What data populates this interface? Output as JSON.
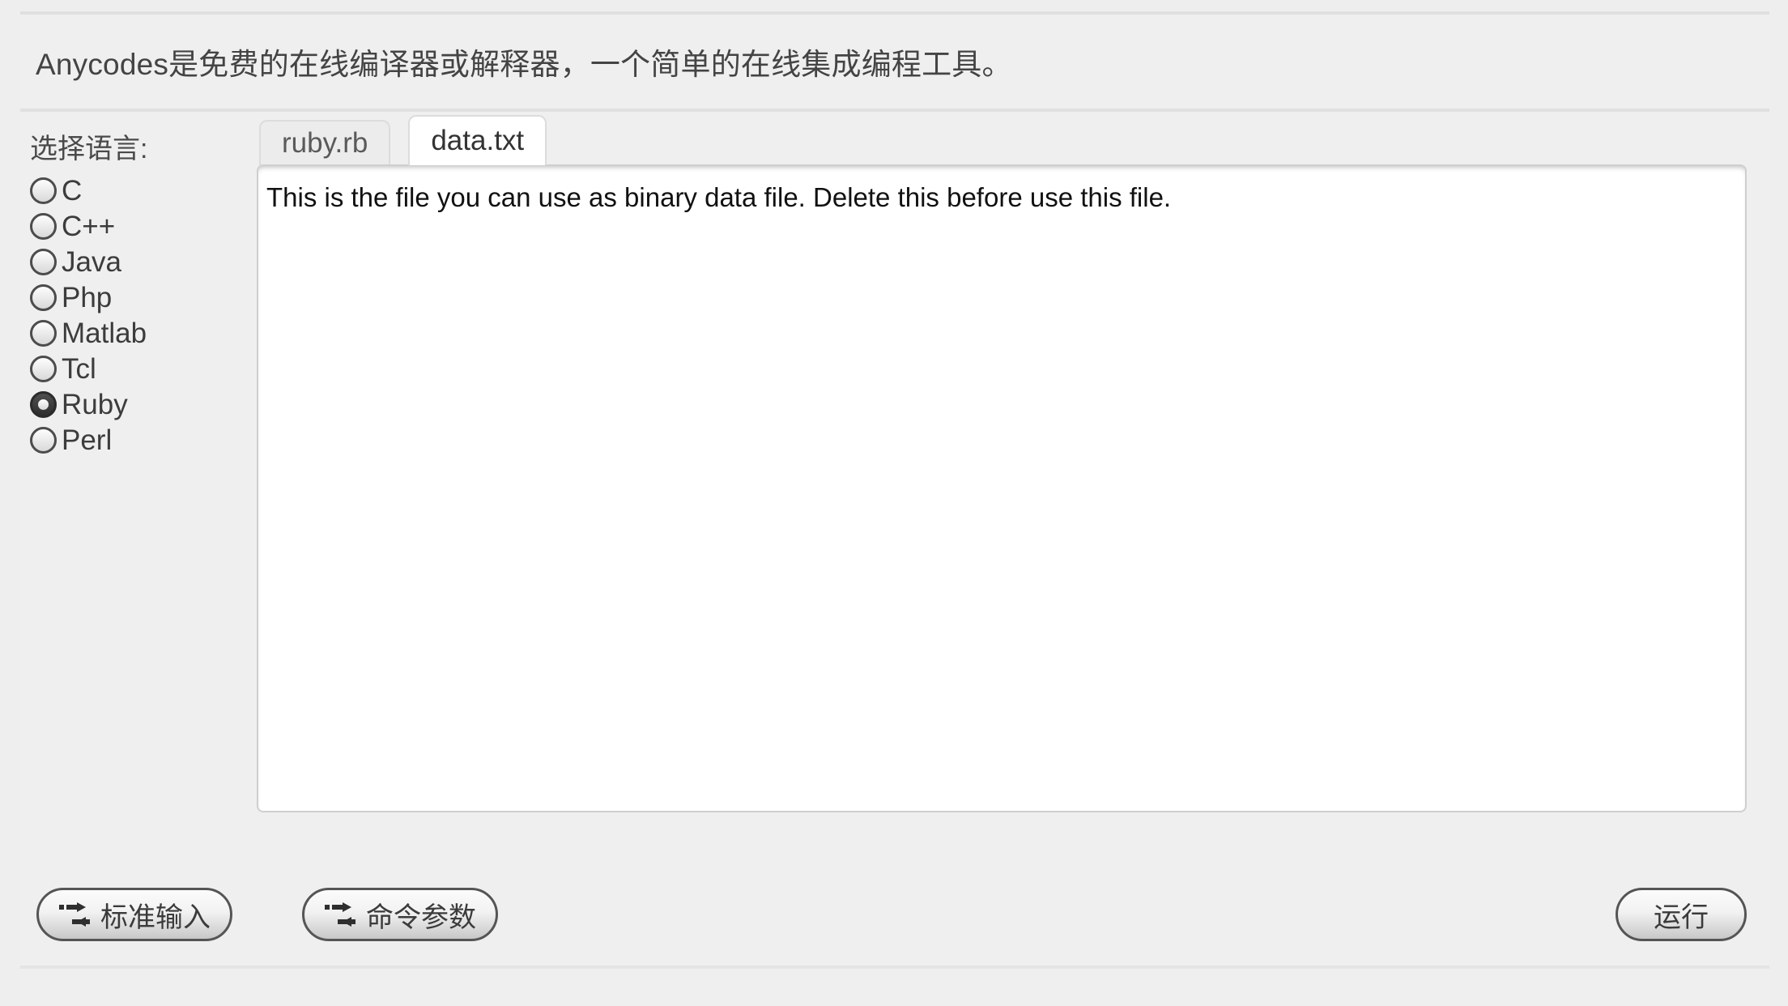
{
  "header": {
    "title": "Anycodes是免费的在线编译器或解释器，一个简单的在线集成编程工具。"
  },
  "language_selector": {
    "label": "选择语言:",
    "selected": "Ruby",
    "options": [
      {
        "label": "C",
        "checked": false
      },
      {
        "label": "C++",
        "checked": false
      },
      {
        "label": "Java",
        "checked": false
      },
      {
        "label": "Php",
        "checked": false
      },
      {
        "label": "Matlab",
        "checked": false
      },
      {
        "label": "Tcl",
        "checked": false
      },
      {
        "label": "Ruby",
        "checked": true
      },
      {
        "label": "Perl",
        "checked": false
      }
    ]
  },
  "editor": {
    "tabs": [
      {
        "label": "ruby.rb",
        "active": false
      },
      {
        "label": "data.txt",
        "active": true
      }
    ],
    "active_tab": "data.txt",
    "content": "This is the file you can use as binary data file. Delete this before use this file."
  },
  "toolbar": {
    "stdin_label": "标准输入",
    "args_label": "命令参数",
    "run_label": "运行",
    "stdin_icon": "exchange-arrows-icon",
    "args_icon": "exchange-arrows-icon"
  },
  "colors": {
    "page_background": "#eeeeee",
    "panel_background": "#efefef",
    "divider": "#e0e0e0",
    "editor_background": "#ffffff",
    "text": "#3c3c3c",
    "button_border": "#555555"
  }
}
